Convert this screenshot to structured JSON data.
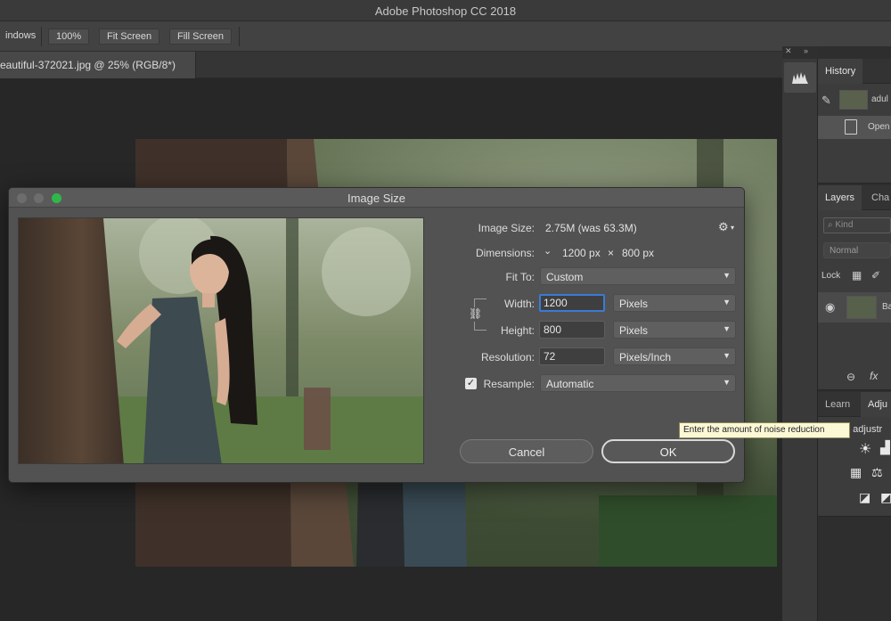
{
  "app": {
    "window_title": "Adobe Photoshop CC 2018"
  },
  "options_bar": {
    "windows_label": "indows",
    "zoom_100_label": "100%",
    "fit_screen_label": "Fit Screen",
    "fill_screen_label": "Fill Screen"
  },
  "document": {
    "tab_label": "eautiful-372021.jpg @ 25% (RGB/8*)"
  },
  "panels": {
    "history": {
      "tab_label": "History",
      "items": [
        {
          "label": "adul"
        },
        {
          "label": "Open"
        }
      ]
    },
    "layers": {
      "tab_label": "Layers",
      "tab2_label": "Cha",
      "kind_placeholder": "Kind",
      "blend_mode": "Normal",
      "lock_label": "Lock",
      "layer_name": "Ba"
    },
    "adjustments": {
      "learn_tab_label": "Learn",
      "adj_tab_label": "Adju",
      "subtitle": "n adjustr"
    }
  },
  "dialog": {
    "title": "Image Size",
    "image_size_label": "Image Size:",
    "image_size_value": "2.75M (was 63.3M)",
    "dimensions_label": "Dimensions:",
    "dimensions_width": "1200 px",
    "dimensions_sep": "×",
    "dimensions_height": "800 px",
    "fit_to_label": "Fit To:",
    "fit_to_value": "Custom",
    "width_label": "Width:",
    "width_value": "1200",
    "width_unit": "Pixels",
    "height_label": "Height:",
    "height_value": "800",
    "height_unit": "Pixels",
    "resolution_label": "Resolution:",
    "resolution_value": "72",
    "resolution_unit": "Pixels/Inch",
    "resample_label": "Resample:",
    "resample_checked": true,
    "resample_value": "Automatic",
    "cancel_label": "Cancel",
    "ok_label": "OK"
  },
  "tooltip": {
    "text": "Enter the amount of noise reduction"
  },
  "colors": {
    "accent": "#3a7ad8",
    "close_dot": "#6d6d6d",
    "zoom_dot": "#2fb84a"
  }
}
